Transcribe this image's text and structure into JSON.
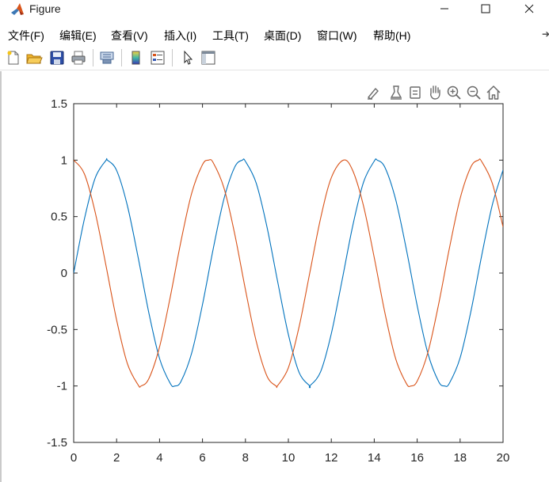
{
  "window": {
    "title": "Figure",
    "controls": [
      "minimize",
      "maximize",
      "close"
    ]
  },
  "menubar": {
    "items": [
      "文件(F)",
      "编辑(E)",
      "查看(V)",
      "插入(I)",
      "工具(T)",
      "桌面(D)",
      "窗口(W)",
      "帮助(H)"
    ],
    "overflow_icon": "arrow-icon"
  },
  "toolbar": {
    "icons": [
      "new-figure-icon",
      "open-file-icon",
      "save-icon",
      "print-icon",
      "link-plot-icon",
      "insert-colorbar-icon",
      "insert-legend-icon",
      "edit-plot-icon",
      "property-inspector-icon"
    ]
  },
  "axes_toolbar": {
    "icons": [
      "brush-icon",
      "data-tips-icon",
      "rotate-icon",
      "pan-icon",
      "zoom-in-icon",
      "zoom-out-icon",
      "home-icon"
    ]
  },
  "colors": {
    "sin_series": "#0072BD",
    "cos_series": "#D95319",
    "axis": "#262626"
  },
  "chart_data": {
    "type": "line",
    "title": "",
    "xlabel": "",
    "ylabel": "",
    "xlim": [
      0,
      20
    ],
    "ylim": [
      -1.5,
      1.5
    ],
    "xticks": [
      "0",
      "2",
      "4",
      "6",
      "8",
      "10",
      "12",
      "14",
      "16",
      "18",
      "20"
    ],
    "yticks": [
      "-1.5",
      "-1",
      "-0.5",
      "0",
      "0.5",
      "1",
      "1.5"
    ],
    "grid": false,
    "legend": "none",
    "series": [
      {
        "color": "#0072BD",
        "x": [
          0,
          0.5,
          1,
          1.5,
          1.571,
          2,
          2.5,
          3,
          3.5,
          4,
          4.5,
          4.712,
          5,
          5.5,
          6,
          6.5,
          7,
          7.5,
          7.854,
          8,
          8.5,
          9,
          9.5,
          10,
          10.5,
          10.996,
          11,
          11.5,
          12,
          12.5,
          13,
          13.5,
          14,
          14.137,
          14.5,
          15,
          15.5,
          16,
          16.5,
          17,
          17.279,
          17.5,
          18,
          18.5,
          19,
          19.5,
          20
        ],
        "y": [
          0,
          0.479,
          0.841,
          0.997,
          1,
          0.909,
          0.598,
          0.141,
          -0.351,
          -0.757,
          -0.978,
          -1,
          -0.959,
          -0.706,
          -0.279,
          0.215,
          0.657,
          0.938,
          1,
          0.989,
          0.798,
          0.412,
          -0.075,
          -0.544,
          -0.88,
          -1,
          -1,
          -0.875,
          -0.537,
          -0.066,
          0.42,
          0.804,
          0.991,
          1,
          0.935,
          0.65,
          0.206,
          -0.288,
          -0.712,
          -0.961,
          -1,
          -0.976,
          -0.751,
          -0.342,
          0.15,
          0.604,
          0.913
        ]
      },
      {
        "color": "#D95319",
        "x": [
          0,
          0.5,
          1,
          1.5,
          2,
          2.5,
          3,
          3.142,
          3.5,
          4,
          4.5,
          5,
          5.5,
          6,
          6.283,
          6.5,
          7,
          7.5,
          8,
          8.5,
          9,
          9.425,
          9.5,
          10,
          10.5,
          11,
          11.5,
          12,
          12.566,
          13,
          13.5,
          14,
          14.5,
          15,
          15.5,
          15.708,
          16,
          16.5,
          17,
          17.5,
          18,
          18.5,
          18.85,
          19,
          19.5,
          20
        ],
        "y": [
          1,
          0.878,
          0.54,
          0.071,
          -0.416,
          -0.801,
          -0.99,
          -1,
          -0.936,
          -0.654,
          -0.211,
          0.284,
          0.709,
          0.96,
          1,
          0.977,
          0.754,
          0.347,
          -0.146,
          -0.602,
          -0.911,
          -1,
          -0.997,
          -0.839,
          -0.476,
          0.004,
          0.484,
          0.844,
          1,
          0.907,
          0.595,
          0.137,
          -0.355,
          -0.76,
          -0.979,
          -1,
          -0.958,
          -0.703,
          -0.275,
          0.219,
          0.66,
          0.939,
          1,
          0.989,
          0.795,
          0.408
        ]
      }
    ]
  }
}
